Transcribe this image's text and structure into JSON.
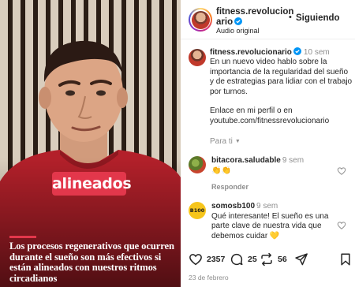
{
  "video": {
    "caption_word": "alineados",
    "overlay_text": "Los procesos regenerativos que ocurren durante el sueño son más efectivos si están alineados con nuestros ritmos circadianos"
  },
  "header": {
    "username": "fitness.revolucionario",
    "audio": "Audio original",
    "separator": "•",
    "follow_label": "Siguiendo"
  },
  "caption": {
    "username": "fitness.revolucionario",
    "time": "10 sem",
    "text": "En un nuevo video hablo sobre la importancia de la regularidad del sueño y de estrategias para lidiar con el trabajo por turnos.\n\nEnlace en mi perfil o en youtube.com/fitnessrevolucionario",
    "for_you": "Para ti"
  },
  "comments": [
    {
      "username": "bitacora.saludable",
      "time": "9 sem",
      "text": "👏👏",
      "reply_label": "Responder"
    },
    {
      "username": "somosb100",
      "time": "9 sem",
      "text": "Qué interesante! El sueño es una parte clave de nuestra vida que debemos cuidar 💛",
      "avatar_text": "B100"
    }
  ],
  "actions": {
    "likes": "2357",
    "comments": "25",
    "shares": "56"
  },
  "date": "23 de febrero",
  "colors": {
    "accent_red": "#e3374b",
    "verified_blue": "#0095f6",
    "muted": "#8e8e8e"
  },
  "icons": [
    "heart-icon",
    "comment-icon",
    "repost-icon",
    "send-icon",
    "bookmark-icon",
    "verified-icon",
    "chevron-down-icon"
  ]
}
